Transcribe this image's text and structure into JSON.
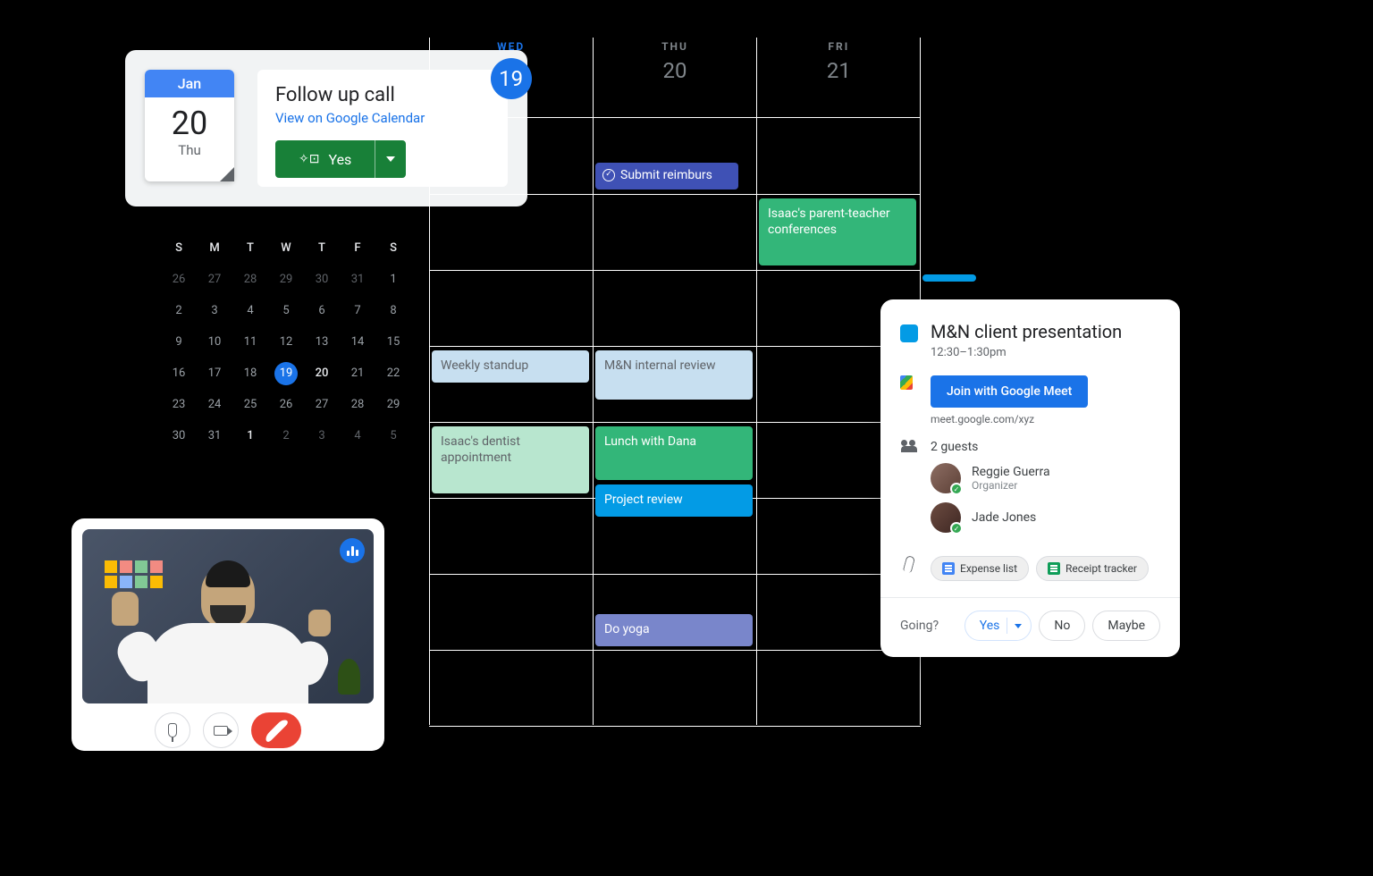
{
  "followup": {
    "month": "Jan",
    "day": "20",
    "dow": "Thu",
    "title": "Follow up call",
    "link": "View on Google Calendar",
    "yes": "Yes"
  },
  "mini_cal": {
    "headers": [
      "S",
      "M",
      "T",
      "W",
      "T",
      "F",
      "S"
    ],
    "rows": [
      [
        {
          "n": "26",
          "c": "prev"
        },
        {
          "n": "27",
          "c": "prev"
        },
        {
          "n": "28",
          "c": "prev"
        },
        {
          "n": "29",
          "c": "prev"
        },
        {
          "n": "30",
          "c": "prev"
        },
        {
          "n": "31",
          "c": "prev"
        },
        {
          "n": "1",
          "c": ""
        }
      ],
      [
        {
          "n": "2",
          "c": ""
        },
        {
          "n": "3",
          "c": ""
        },
        {
          "n": "4",
          "c": ""
        },
        {
          "n": "5",
          "c": ""
        },
        {
          "n": "6",
          "c": ""
        },
        {
          "n": "7",
          "c": ""
        },
        {
          "n": "8",
          "c": ""
        }
      ],
      [
        {
          "n": "9",
          "c": ""
        },
        {
          "n": "10",
          "c": ""
        },
        {
          "n": "11",
          "c": ""
        },
        {
          "n": "12",
          "c": ""
        },
        {
          "n": "13",
          "c": ""
        },
        {
          "n": "14",
          "c": ""
        },
        {
          "n": "15",
          "c": ""
        }
      ],
      [
        {
          "n": "16",
          "c": ""
        },
        {
          "n": "17",
          "c": ""
        },
        {
          "n": "18",
          "c": ""
        },
        {
          "n": "19",
          "c": "today"
        },
        {
          "n": "20",
          "c": "bold"
        },
        {
          "n": "21",
          "c": ""
        },
        {
          "n": "22",
          "c": ""
        }
      ],
      [
        {
          "n": "23",
          "c": ""
        },
        {
          "n": "24",
          "c": ""
        },
        {
          "n": "25",
          "c": ""
        },
        {
          "n": "26",
          "c": ""
        },
        {
          "n": "27",
          "c": ""
        },
        {
          "n": "28",
          "c": ""
        },
        {
          "n": "29",
          "c": ""
        }
      ],
      [
        {
          "n": "30",
          "c": ""
        },
        {
          "n": "31",
          "c": ""
        },
        {
          "n": "1",
          "c": "bold"
        },
        {
          "n": "2",
          "c": "next"
        },
        {
          "n": "3",
          "c": "next"
        },
        {
          "n": "4",
          "c": "next"
        },
        {
          "n": "5",
          "c": "next"
        }
      ]
    ]
  },
  "week": {
    "days": [
      {
        "dow": "WED",
        "date": "19",
        "active": true
      },
      {
        "dow": "THU",
        "date": "20",
        "active": false
      },
      {
        "dow": "FRI",
        "date": "21",
        "active": false
      }
    ],
    "events": {
      "submit": "Submit reimburs",
      "parent_teacher": "Isaac's parent-teacher conferences",
      "standup": "Weekly standup",
      "internal_review": "M&N internal review",
      "dentist": "Isaac's dentist appointment",
      "lunch": "Lunch with Dana",
      "project_review": "Project review",
      "yoga": "Do yoga"
    }
  },
  "detail": {
    "title": "M&N client presentation",
    "time": "12:30–1:30pm",
    "join": "Join with Google Meet",
    "url": "meet.google.com/xyz",
    "guest_count": "2 guests",
    "guests": [
      {
        "name": "Reggie Guerra",
        "role": "Organizer"
      },
      {
        "name": "Jade Jones",
        "role": ""
      }
    ],
    "attachments": [
      {
        "label": "Expense list",
        "type": "doc"
      },
      {
        "label": "Receipt tracker",
        "type": "sheet"
      }
    ],
    "going": "Going?",
    "rsvp": {
      "yes": "Yes",
      "no": "No",
      "maybe": "Maybe"
    }
  }
}
